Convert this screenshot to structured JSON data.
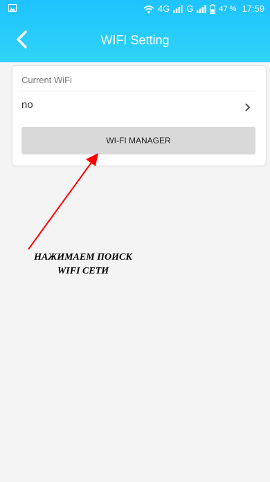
{
  "status_bar": {
    "network_1": "4G",
    "network_2": "G",
    "battery_percent": "47 %",
    "time": "17:59"
  },
  "nav": {
    "title": "WIFI Setting"
  },
  "wifi_card": {
    "header": "Current WiFi",
    "value": "no",
    "button_label": "WI-FI MANAGER"
  },
  "annotation": {
    "line_1": "НАЖИМАЕМ ПОИСК",
    "line_2": "WIFI СЕТИ"
  },
  "colors": {
    "header_gradient_top": "#1ec3ff",
    "header_gradient_bottom": "#2fd4f7",
    "page_background": "#f4f4f4",
    "button_background": "#d9d9d9",
    "annotation_arrow": "#ff0000"
  },
  "icons": {
    "status_left": "image-icon",
    "wifi": "wifi-icon",
    "signal": "signal-icon",
    "battery": "battery-icon",
    "back": "chevron-left-icon",
    "row_arrow": "chevron-right-icon"
  }
}
